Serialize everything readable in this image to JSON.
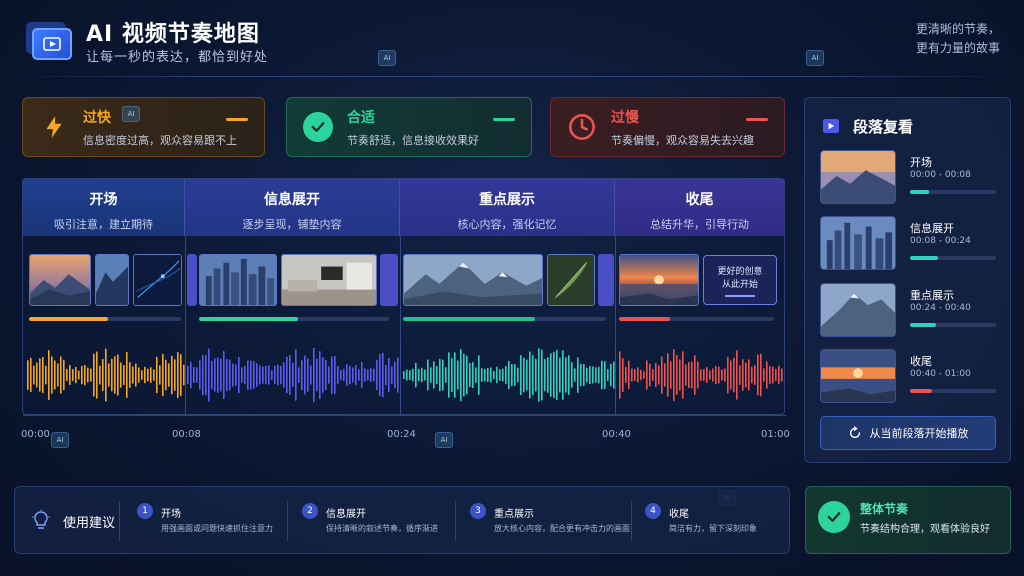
{
  "header": {
    "title": "AI 视频节奏地图",
    "subtitle": "让每一秒的表达，都恰到好处",
    "slogan_line1": "更清晰的节奏，",
    "slogan_line2": "更有力量的故事"
  },
  "pace": [
    {
      "label": "过快",
      "desc": "信息密度过高，观众容易跟不上",
      "color": "#f5a623",
      "icon": "lightning-icon"
    },
    {
      "label": "合适",
      "desc": "节奏舒适，信息接收效果好",
      "color": "#2dd39d",
      "icon": "check-icon"
    },
    {
      "label": "过慢",
      "desc": "节奏偏慢，观众容易失去兴趣",
      "color": "#ef5350",
      "icon": "clock-icon"
    }
  ],
  "segments": [
    {
      "name": "开场",
      "desc": "吸引注意，建立期待",
      "color": "#f5a623",
      "progress": 0.52
    },
    {
      "name": "信息展开",
      "desc": "逐步呈现，铺垫内容",
      "color": "#2dd39d",
      "progress": 0.52
    },
    {
      "name": "重点展示",
      "desc": "核心内容，强化记忆",
      "color": "#22c08c",
      "progress": 0.65
    },
    {
      "name": "收尾",
      "desc": "总结升华，引导行动",
      "color": "#ef5350",
      "progress": 0.33
    }
  ],
  "callout": {
    "line1": "更好的创意",
    "line2": "从此开始"
  },
  "ticks": [
    "00:00",
    "00:08",
    "00:24",
    "00:40",
    "01:00"
  ],
  "review": {
    "title": "段落复看",
    "items": [
      {
        "name": "开场",
        "time": "00:00 - 00:08",
        "progress": 0.22,
        "color": "#2dd3c0"
      },
      {
        "name": "信息展开",
        "time": "00:08 - 00:24",
        "progress": 0.32,
        "color": "#2dd3c0"
      },
      {
        "name": "重点展示",
        "time": "00:24 - 00:40",
        "progress": 0.3,
        "color": "#2dd3c0"
      },
      {
        "name": "收尾",
        "time": "00:40 - 01:00",
        "progress": 0.25,
        "color": "#ef5350"
      }
    ],
    "play_label": "从当前段落开始播放"
  },
  "tips": {
    "title": "使用建议",
    "items": [
      {
        "num": "1",
        "name": "开场",
        "desc": "用强画面或问题快速抓住注意力"
      },
      {
        "num": "2",
        "name": "信息展开",
        "desc": "保持清晰的叙述节奏，循序渐进"
      },
      {
        "num": "3",
        "name": "重点展示",
        "desc": "放大核心内容，配合更有冲击力的画面"
      },
      {
        "num": "4",
        "name": "收尾",
        "desc": "简洁有力，留下深刻印象"
      }
    ]
  },
  "overall": {
    "title": "整体节奏",
    "desc": "节奏结构合理，观看体验良好"
  }
}
